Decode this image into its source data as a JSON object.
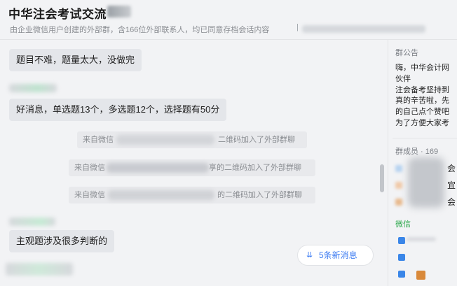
{
  "header": {
    "title": "中华注会考试交流",
    "subtitle": "由企业微信用户创建的外部群，含166位外部联系人，均已同意存档会话内容",
    "separator": "|"
  },
  "messages": [
    {
      "text": "题目不难，题量太大，没做完"
    },
    {
      "text": "好消息，单选题13个，多选题12个，选择题有50分"
    },
    {
      "text": "主观题涉及很多判断的"
    }
  ],
  "system_notices": [
    {
      "prefix": "来自微信",
      "suffix": "二维码加入了外部群聊"
    },
    {
      "prefix": "来自微信",
      "suffix": "享的二维码加入了外部群聊"
    },
    {
      "prefix": "来自微信",
      "suffix": "的二维码加入了外部群聊"
    }
  ],
  "new_messages_button": {
    "icon": "double-chevron-down-icon",
    "label": "5条新消息"
  },
  "sidebar": {
    "announcement_title": "群公告",
    "announcement_lines": [
      "嗨，中华会计网",
      "伙伴",
      "注会备考坚持到",
      "真的辛苦啦，先",
      "的自己点个赞吧",
      "为了方便大家考"
    ],
    "members_title": "群成员 · 169",
    "member_suffixes": [
      "会",
      "宜",
      "会"
    ],
    "wechat_label": "微信"
  },
  "colors": {
    "accent": "#3d7cf2",
    "wechat_green": "#2fa94e",
    "bubble": "#e4e6ea"
  }
}
